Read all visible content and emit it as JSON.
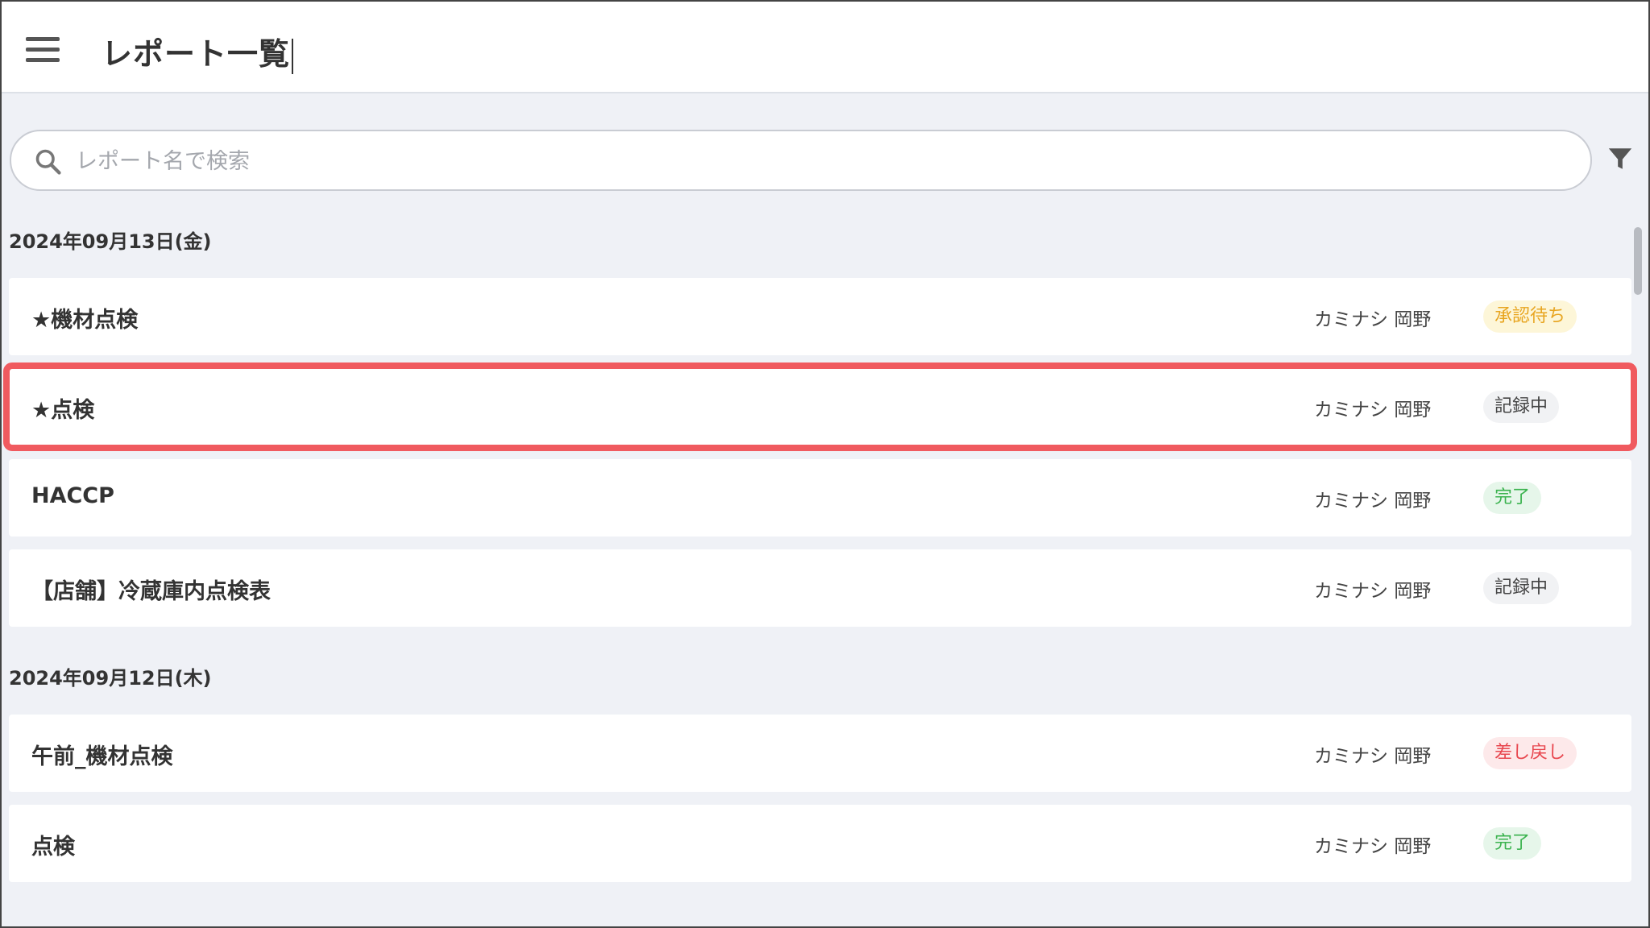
{
  "header": {
    "title": "レポート一覧"
  },
  "search": {
    "placeholder": "レポート名で検索"
  },
  "groups": [
    {
      "date": "2024年09月13日(金)",
      "reports": [
        {
          "title": "★機材点検",
          "user": "カミナシ 岡野",
          "status": "承認待ち",
          "status_kind": "pending"
        },
        {
          "title": "★点検",
          "user": "カミナシ 岡野",
          "status": "記録中",
          "status_kind": "recording",
          "selected": true
        },
        {
          "title": "HACCP",
          "user": "カミナシ 岡野",
          "status": "完了",
          "status_kind": "done"
        },
        {
          "title": "【店舗】冷蔵庫内点検表",
          "user": "カミナシ 岡野",
          "status": "記録中",
          "status_kind": "recording"
        }
      ]
    },
    {
      "date": "2024年09月12日(木)",
      "reports": [
        {
          "title": "午前_機材点検",
          "user": "カミナシ 岡野",
          "status": "差し戻し",
          "status_kind": "returned"
        },
        {
          "title": "点検",
          "user": "カミナシ 岡野",
          "status": "完了",
          "status_kind": "done"
        }
      ]
    }
  ],
  "colors": {
    "background": "#eff1f6",
    "selected_outline": "#f05a5f",
    "pending": "#e8a520",
    "done": "#3bb34f",
    "returned": "#e8474f"
  },
  "icons": {
    "menu": "hamburger-menu-icon",
    "search": "search-icon",
    "filter": "filter-icon"
  }
}
